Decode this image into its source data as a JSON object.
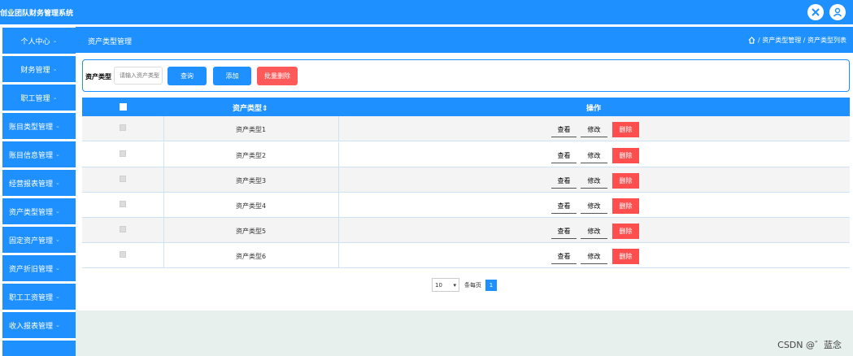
{
  "app": {
    "title": "创业团队财务管理系统"
  },
  "sidebar": {
    "items": [
      {
        "label": "个人中心"
      },
      {
        "label": "财务管理"
      },
      {
        "label": "职工管理"
      },
      {
        "label": "账目类型管理"
      },
      {
        "label": "账目信息管理"
      },
      {
        "label": "经营报表管理"
      },
      {
        "label": "资产类型管理"
      },
      {
        "label": "固定资产管理"
      },
      {
        "label": "资产折旧管理"
      },
      {
        "label": "职工工资管理"
      },
      {
        "label": "收入报表管理"
      }
    ]
  },
  "header": {
    "title": "资产类型管理",
    "breadcrumb": "/ 资产类型管理 / 资产类型列表"
  },
  "search": {
    "label": "资产类型",
    "placeholder": "请输入资产类型",
    "query_label": "查询",
    "add_label": "添加",
    "batch_delete_label": "批量删除"
  },
  "table": {
    "columns": {
      "name": "资产类型⇕",
      "actions": "操作"
    },
    "rows": [
      {
        "name": "资产类型1"
      },
      {
        "name": "资产类型2"
      },
      {
        "name": "资产类型3"
      },
      {
        "name": "资产类型4"
      },
      {
        "name": "资产类型5"
      },
      {
        "name": "资产类型6"
      }
    ],
    "action_labels": {
      "view": "查看",
      "edit": "修改",
      "delete": "删除"
    }
  },
  "pagination": {
    "page_size": "10",
    "per_page_label": "条每页",
    "current_page": "1"
  },
  "watermark": "CSDN @゛蓝念"
}
